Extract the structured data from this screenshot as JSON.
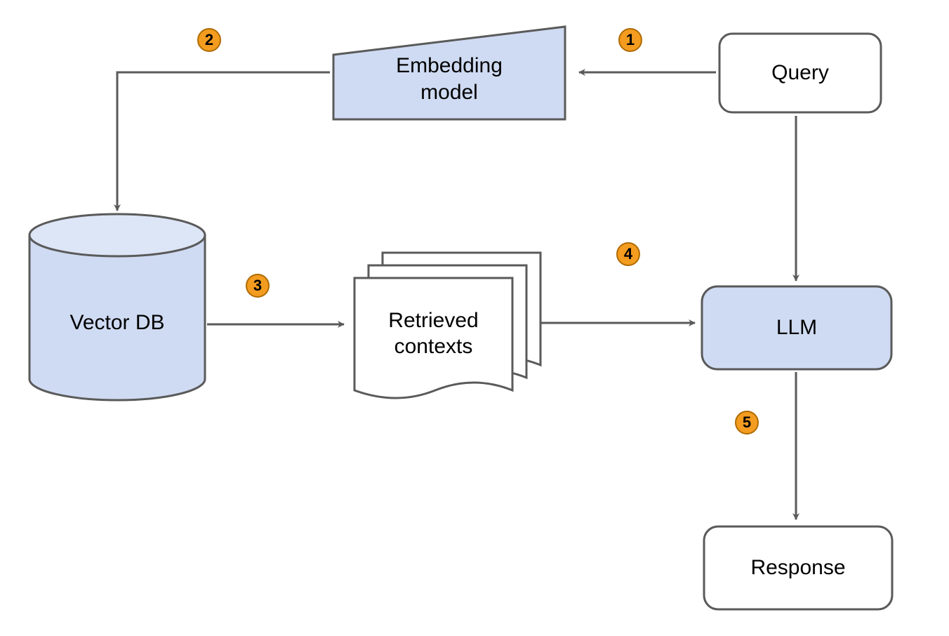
{
  "nodes": {
    "query": "Query",
    "embedding": "Embedding\nmodel",
    "vectordb": "Vector DB",
    "retrieved": "Retrieved\ncontexts",
    "llm": "LLM",
    "response": "Response"
  },
  "steps": {
    "s1": "1",
    "s2": "2",
    "s3": "3",
    "s4": "4",
    "s5": "5"
  },
  "colors": {
    "accent_fill": "#cfdbf2",
    "accent_fill_light": "#dde6f7",
    "stroke": "#5a5a5a",
    "badge_fill": "#f39c1f",
    "badge_border": "#b06b02"
  }
}
